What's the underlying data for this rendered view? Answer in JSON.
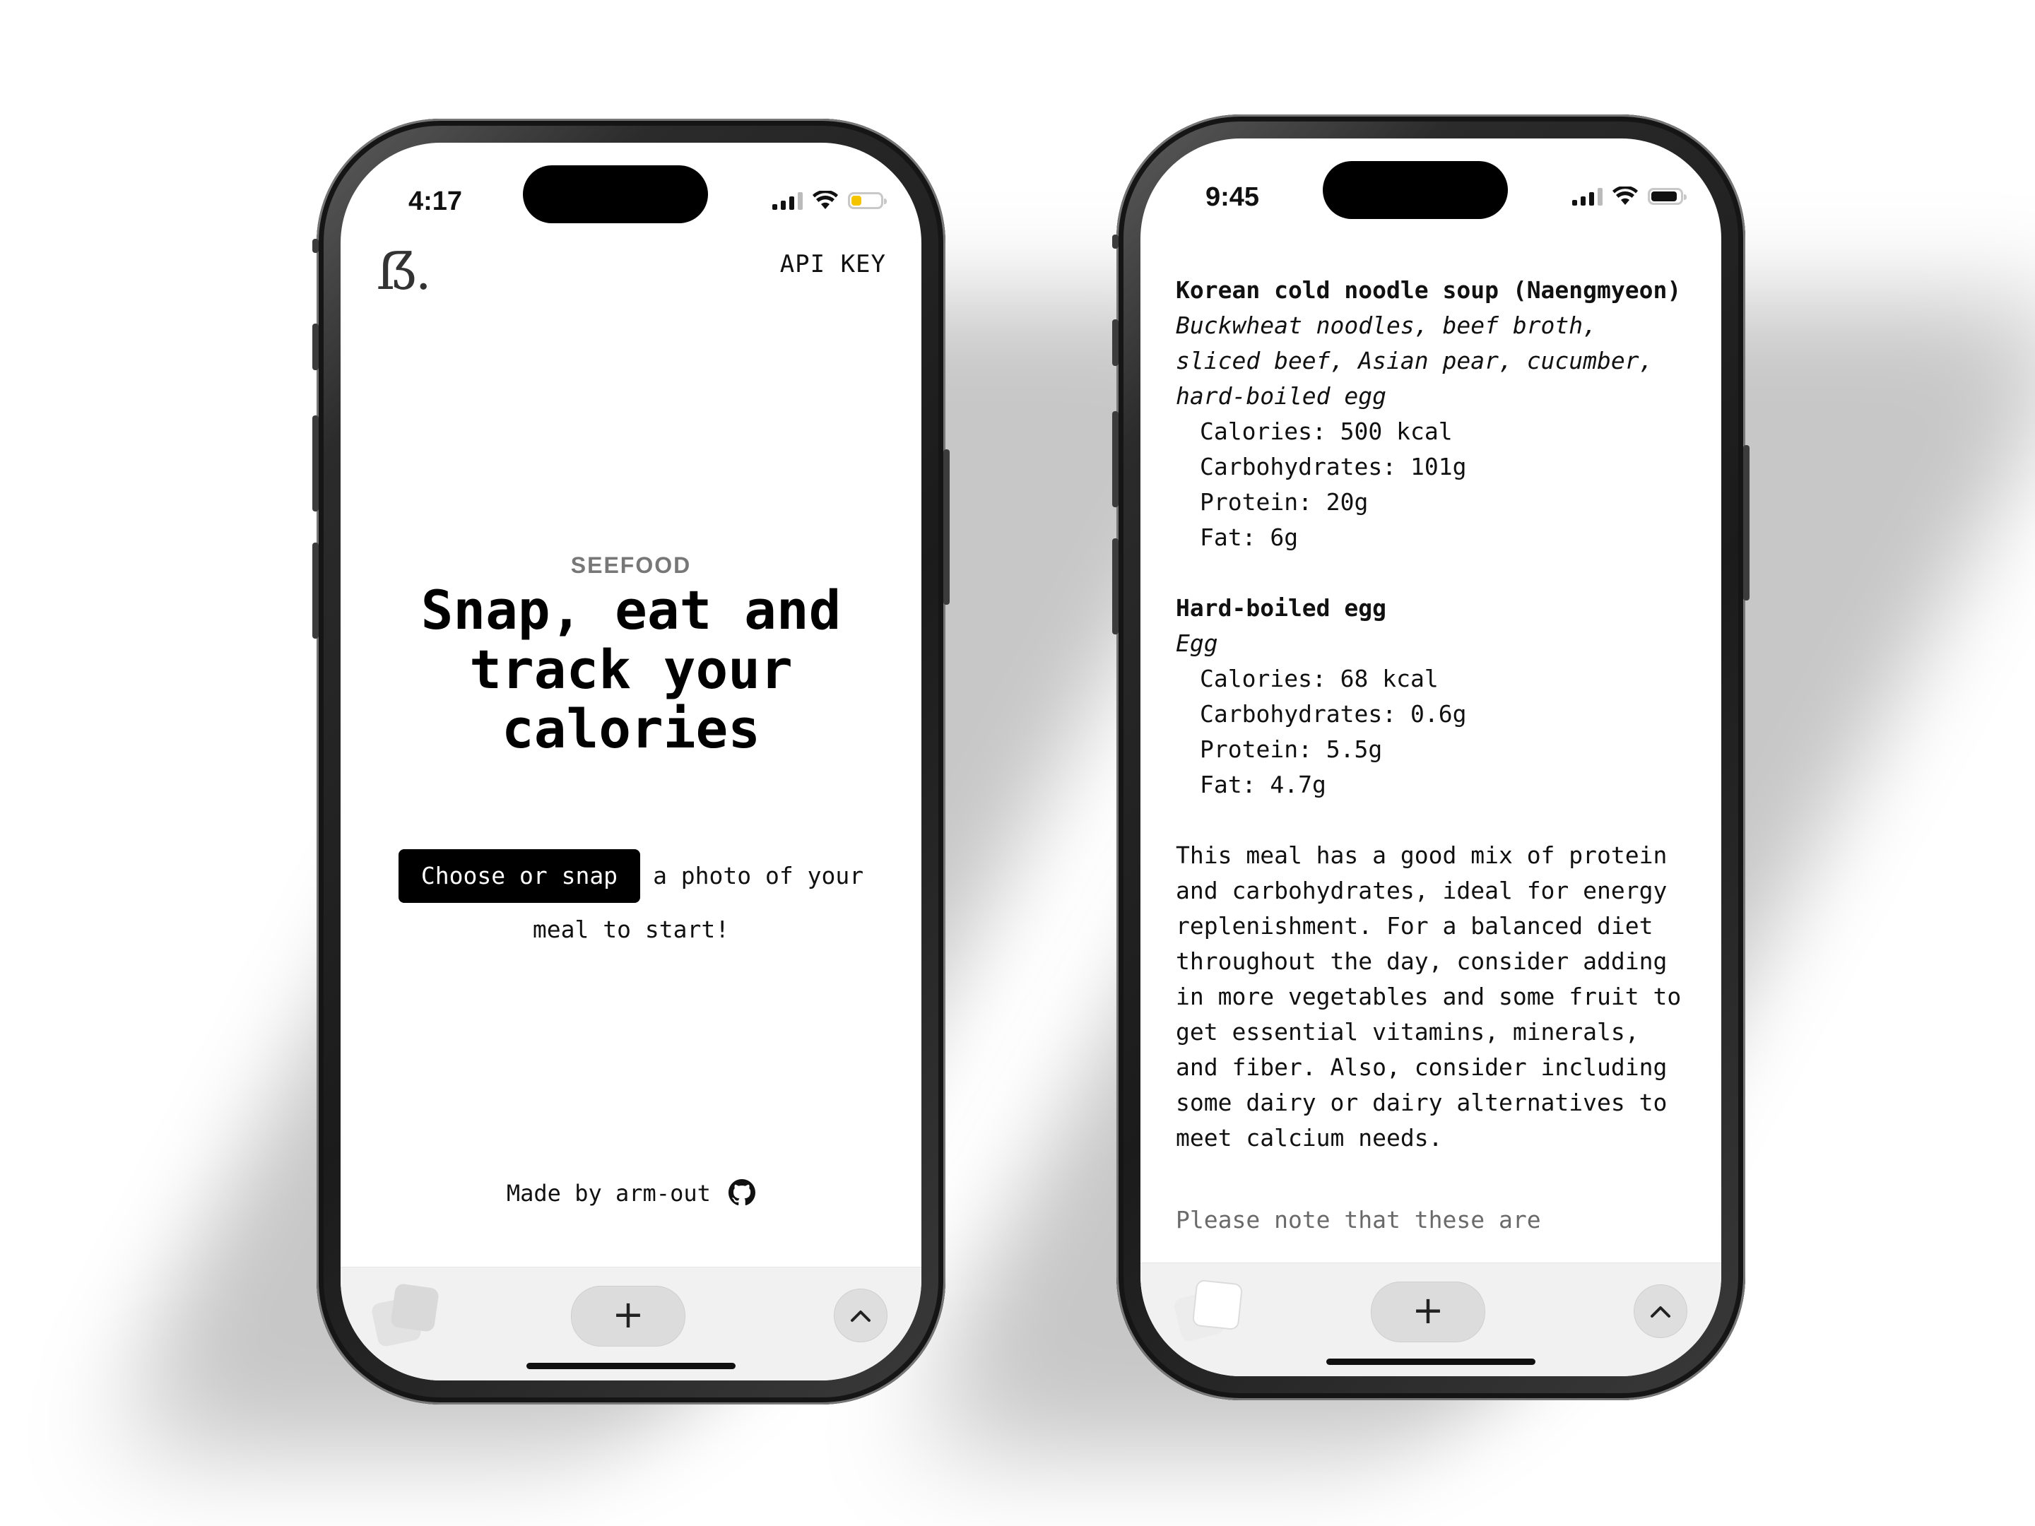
{
  "colors": {
    "background": "#ffffff",
    "phone_frame": "#1b1b1b",
    "cta_button": "#000000",
    "eyebrow_text": "#777777",
    "toolbar": "#f1f1f1",
    "battery_low": "#f5c400"
  },
  "left_phone": {
    "status": {
      "time": "4:17",
      "battery_color": "#f5c400",
      "battery_level": 0.35
    },
    "header": {
      "logo": "ẞ.",
      "api_key_label": "API KEY"
    },
    "hero": {
      "eyebrow": "SEEFOOD",
      "headline": "Snap, eat and track your calories",
      "cta_button": "Choose or snap",
      "cta_text": "a photo of your meal to start!"
    },
    "footer": {
      "credit": "Made by arm-out",
      "icon": "github-icon"
    },
    "toolbar": {
      "tabs_icon": "tabs-icon",
      "new_tab": "+",
      "up_icon": "chevron-up-icon"
    }
  },
  "right_phone": {
    "status": {
      "time": "9:45",
      "battery_color": "#111111",
      "battery_level": 0.9
    },
    "foods": [
      {
        "name": "Korean cold noodle soup (Naengmyeon)",
        "ingredients": "Buckwheat noodles, beef broth, sliced beef, Asian pear, cucumber, hard-boiled egg",
        "calories": "Calories: 500 kcal",
        "carbs": "Carbohydrates: 101g",
        "protein": "Protein: 20g",
        "fat": "Fat: 6g"
      },
      {
        "name": "Hard-boiled egg",
        "ingredients": "Egg",
        "calories": "Calories: 68 kcal",
        "carbs": "Carbohydrates: 0.6g",
        "protein": "Protein: 5.5g",
        "fat": "Fat: 4.7g"
      }
    ],
    "summary": "This meal has a good mix of protein and carbohydrates, ideal for energy replenishment. For a balanced diet throughout the day, consider adding in more vegetables and some fruit to get essential vitamins, minerals, and fiber. Also, consider including some dairy or dairy alternatives to meet calcium needs.",
    "note": "Please note that these are",
    "toolbar": {
      "tabs_icon": "tabs-icon",
      "new_tab": "+",
      "up_icon": "chevron-up-icon"
    }
  }
}
